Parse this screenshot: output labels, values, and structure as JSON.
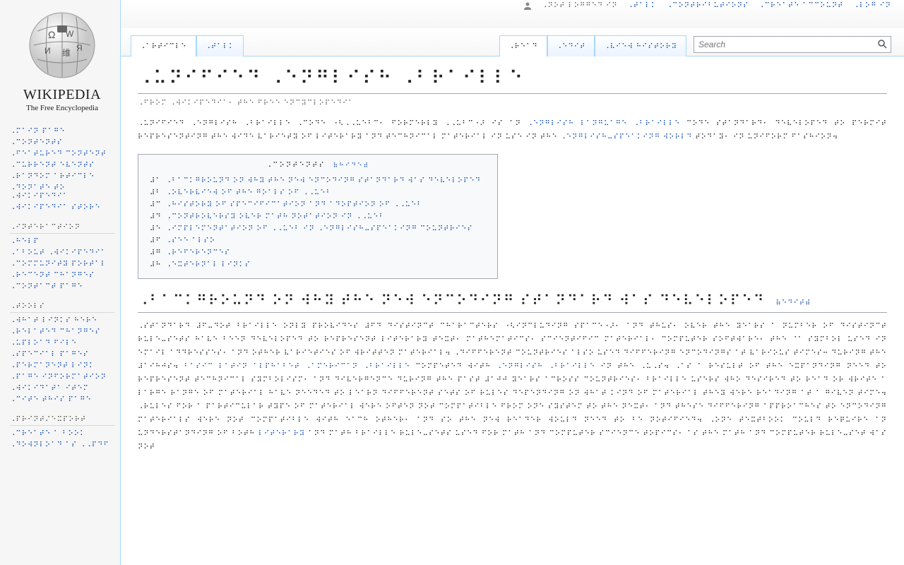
{
  "site": {
    "name": "WIKIPEDIA",
    "tagline": "The Free Encyclopedia"
  },
  "user_links": {
    "not_logged": "⠠⠝⠕⠞ ⠇⠕⠛⠛⠑⠙ ⠊⠝",
    "talk": "⠠⠞⠁⠇⠅",
    "contributions": "⠠⠉⠕⠝⠞⠗⠊⠃⠥⠞⠊⠕⠝⠎",
    "create": "⠠⠉⠗⠑⠁⠞⠑ ⠁⠉⠉⠕⠥⠝⠞",
    "login": "⠠⠇⠕⠛ ⠊⠝"
  },
  "nav": {
    "main": [
      "⠠⠍⠁⠊⠝ ⠏⠁⠛⠑",
      "⠠⠉⠕⠝⠞⠑⠝⠞⠎",
      "⠠⠋⠑⠁⠞⠥⠗⠑⠙ ⠉⠕⠝⠞⠑⠝⠞",
      "⠠⠉⠥⠗⠗⠑⠝⠞ ⠑⠧⠑⠝⠞⠎",
      "⠠⠗⠁⠝⠙⠕⠍ ⠁⠗⠞⠊⠉⠇⠑",
      "⠠⠙⠕⠝⠁⠞⠑ ⠞⠕ ⠠⠺⠊⠅⠊⠏⠑⠙⠊⠁",
      "⠠⠺⠊⠅⠊⠏⠑⠙⠊⠁ ⠎⠞⠕⠗⠑"
    ],
    "interaction_head": "⠠⠊⠝⠞⠑⠗⠁⠉⠞⠊⠕⠝",
    "interaction": [
      "⠠⠓⠑⠇⠏",
      "⠠⠁⠃⠕⠥⠞ ⠠⠺⠊⠅⠊⠏⠑⠙⠊⠁",
      "⠠⠉⠕⠍⠍⠥⠝⠊⠞⠽ ⠏⠕⠗⠞⠁⠇",
      "⠠⠗⠑⠉⠑⠝⠞ ⠉⠓⠁⠝⠛⠑⠎",
      "⠠⠉⠕⠝⠞⠁⠉⠞ ⠏⠁⠛⠑"
    ],
    "tools_head": "⠠⠞⠕⠕⠇⠎",
    "tools": [
      "⠠⠺⠓⠁⠞ ⠇⠊⠝⠅⠎ ⠓⠑⠗⠑",
      "⠠⠗⠑⠇⠁⠞⠑⠙ ⠉⠓⠁⠝⠛⠑⠎",
      "⠠⠥⠏⠇⠕⠁⠙ ⠋⠊⠇⠑",
      "⠠⠎⠏⠑⠉⠊⠁⠇ ⠏⠁⠛⠑⠎",
      "⠠⠏⠑⠗⠍⠁⠝⠑⠝⠞ ⠇⠊⠝⠅",
      "⠠⠏⠁⠛⠑ ⠊⠝⠋⠕⠗⠍⠁⠞⠊⠕⠝",
      "⠠⠺⠊⠅⠊⠙⠁⠞⠁ ⠊⠞⠑⠍",
      "⠠⠉⠊⠞⠑ ⠞⠓⠊⠎ ⠏⠁⠛⠑"
    ],
    "print_head": "⠠⠏⠗⠊⠝⠞⠌⠑⠭⠏⠕⠗⠞",
    "print": [
      "⠠⠉⠗⠑⠁⠞⠑ ⠁ ⠃⠕⠕⠅",
      "⠠⠙⠕⠺⠝⠇⠕⠁⠙ ⠁⠎ ⠠⠠⠏⠙⠋"
    ]
  },
  "tabs_left": {
    "article": "⠠⠁⠗⠞⠊⠉⠇⠑",
    "talk": "⠠⠞⠁⠇⠅"
  },
  "tabs_right": {
    "read": "⠠⠗⠑⠁⠙",
    "edit": "⠠⠑⠙⠊⠞",
    "history": "⠠⠧⠊⠑⠺ ⠓⠊⠎⠞⠕⠗⠽"
  },
  "search": {
    "placeholder": "Search"
  },
  "article": {
    "title": "⠠⠥⠝⠊⠋⠊⠑⠙ ⠠⠑⠝⠛⠇⠊⠎⠓ ⠠⠃⠗⠁⠊⠇⠇⠑",
    "from": "⠠⠋⠗⠕⠍ ⠠⠺⠊⠅⠊⠏⠑⠙⠊⠁⠂ ⠞⠓⠑ ⠋⠗⠑⠑ ⠑⠝⠉⠽⠉⠇⠕⠏⠑⠙⠊⠁",
    "intro_a": "⠠⠥⠝⠊⠋⠊⠑⠙ ⠠⠑⠝⠛⠇⠊⠎⠓ ⠠⠃⠗⠁⠊⠇⠇⠑ ⠠⠉⠕⠙⠑ ⠐⠣⠠⠠⠥⠑⠃⠉⠂ ⠋⠕⠗⠍⠑⠗⠇⠽ ⠠⠠⠥⠃⠉⠐⠜ ⠊⠎ ⠁⠝ ",
    "intro_link1": "⠠⠑⠝⠛⠇⠊⠎⠓ ⠇⠁⠝⠛⠥⠁⠛⠑",
    "intro_link2": "⠠⠃⠗⠁⠊⠇⠇⠑",
    "intro_b": " ⠉⠕⠙⠑ ⠎⠞⠁⠝⠙⠁⠗⠙⠂ ⠙⠑⠧⠑⠇⠕⠏⠑⠙ ⠞⠕ ⠏⠑⠗⠍⠊⠞ ⠗⠑⠏⠗⠑⠎⠑⠝⠞⠊⠝⠛ ⠞⠓⠑ ⠺⠊⠙⠑ ⠧⠁⠗⠊⠑⠞⠽ ⠕⠋ ⠇⠊⠞⠑⠗⠁⠗⠽ ⠁⠝⠙ ⠞⠑⠉⠓⠝⠊⠉⠁⠇ ⠍⠁⠞⠑⠗⠊⠁⠇ ⠊⠝ ⠥⠎⠑ ⠊⠝ ⠞⠓⠑ ",
    "intro_link3": "⠠⠑⠝⠛⠇⠊⠎⠓⠤⠎⠏⠑⠁⠅⠊⠝⠛ ⠺⠕⠗⠇⠙",
    "intro_c": " ⠞⠕⠙⠁⠽⠂ ⠊⠝ ⠥⠝⠊⠋⠕⠗⠍ ⠋⠁⠎⠓⠊⠕⠝⠲",
    "toc_head": "⠠⠉⠕⠝⠞⠑⠝⠞⠎",
    "toc_hide": "⠷⠓⠊⠙⠑⠾",
    "toc": [
      {
        "n": "⠼⠁",
        "t": "⠠⠃⠁⠉⠅⠛⠗⠕⠥⠝⠙ ⠕⠝ ⠺⠓⠽ ⠞⠓⠑ ⠝⠑⠺ ⠑⠝⠉⠕⠙⠊⠝⠛ ⠎⠞⠁⠝⠙⠁⠗⠙ ⠺⠁⠎ ⠙⠑⠧⠑⠇⠕⠏⠑⠙"
      },
      {
        "n": "⠼⠃",
        "t": "⠠⠕⠧⠑⠗⠧⠊⠑⠺ ⠕⠋ ⠞⠓⠑ ⠛⠕⠁⠇⠎ ⠕⠋ ⠠⠠⠥⠑⠃"
      },
      {
        "n": "⠼⠉",
        "t": "⠠⠓⠊⠎⠞⠕⠗⠽ ⠕⠋ ⠎⠏⠑⠉⠊⠋⠊⠉⠁⠞⠊⠕⠝ ⠁⠝⠙ ⠁⠙⠕⠏⠞⠊⠕⠝ ⠕⠋ ⠠⠠⠥⠑⠃"
      },
      {
        "n": "⠼⠙",
        "t": "⠠⠉⠕⠝⠞⠗⠕⠧⠑⠗⠎⠽ ⠕⠧⠑⠗ ⠍⠁⠞⠓ ⠝⠕⠞⠁⠞⠊⠕⠝ ⠊⠝ ⠠⠠⠥⠑⠃"
      },
      {
        "n": "⠼⠑",
        "t": "⠠⠊⠍⠏⠇⠑⠍⠑⠝⠞⠁⠞⠊⠕⠝ ⠕⠋ ⠠⠠⠥⠑⠃ ⠊⠝ ⠠⠑⠝⠛⠇⠊⠎⠓⠤⠎⠏⠑⠁⠅⠊⠝⠛ ⠉⠕⠥⠝⠞⠗⠊⠑⠎"
      },
      {
        "n": "⠼⠋",
        "t": "⠠⠎⠑⠑ ⠁⠇⠎⠕"
      },
      {
        "n": "⠼⠛",
        "t": "⠠⠗⠑⠋⠑⠗⠑⠝⠉⠑⠎"
      },
      {
        "n": "⠼⠓",
        "t": "⠠⠑⠭⠞⠑⠗⠝⠁⠇ ⠇⠊⠝⠅⠎"
      }
    ],
    "h2": "⠠⠃⠁⠉⠅⠛⠗⠕⠥⠝⠙ ⠕⠝ ⠺⠓⠽ ⠞⠓⠑ ⠝⠑⠺ ⠑⠝⠉⠕⠙⠊⠝⠛ ⠎⠞⠁⠝⠙⠁⠗⠙ ⠺⠁⠎ ⠙⠑⠧⠑⠇⠕⠏⠑⠙",
    "h2_edit": "⠷⠑⠙⠊⠞⠾",
    "body_a": "⠠⠎⠞⠁⠝⠙⠁⠗⠙ ⠼⠋⠤⠙⠕⠞ ⠃⠗⠁⠊⠇⠇⠑ ⠕⠝⠇⠽ ⠏⠗⠕⠧⠊⠙⠑⠎ ⠼⠋⠙ ⠙⠊⠎⠞⠊⠝⠉⠞ ⠉⠓⠁⠗⠁⠉⠞⠑⠗⠎ ⠐⠣⠊⠝⠉⠇⠥⠙⠊⠝⠛ ⠎⠏⠁⠉⠑⠐⠜⠂ ⠁⠝⠙ ⠞⠓⠥⠎⠂ ⠕⠧⠑⠗ ⠞⠓⠑ ⠽⠑⠁⠗⠎ ⠁ ⠝⠥⠍⠃⠑⠗ ⠕⠋ ⠙⠊⠎⠞⠊⠝⠉⠞ ⠗⠥⠇⠑⠤⠎⠑⠞⠎ ⠓⠁⠧⠑ ⠃⠑⠑⠝ ⠙⠑⠧⠑⠇⠕⠏⠑⠙ ⠞⠕ ⠗⠑⠏⠗⠑⠎⠑⠝⠞ ⠇⠊⠞⠑⠗⠁⠗⠽ ⠞⠑⠭⠞⠂ ⠍⠁⠞⠓⠑⠍⠁⠞⠊⠉⠎⠂ ⠎⠉⠊⠑⠝⠞⠊⠋⠊⠉ ⠍⠁⠞⠑⠗⠊⠁⠇⠂ ⠉⠕⠍⠏⠥⠞⠑⠗ ⠎⠕⠋⠞⠺⠁⠗⠑⠂ ⠞⠓⠑ ⠈⠁ ⠎⠽⠍⠃⠕⠇ ⠥⠎⠑⠙ ⠊⠝ ⠑⠍⠁⠊⠇ ⠁⠙⠙⠗⠑⠎⠎⠑⠎⠂ ⠁⠝⠙ ⠕⠞⠓⠑⠗ ⠧⠁⠗⠊⠑⠞⠊⠑⠎ ⠕⠋ ⠺⠗⠊⠞⠞⠑⠝ ⠍⠁⠞⠑⠗⠊⠁⠇⠲ ⠠⠙⠊⠋⠋⠑⠗⠑⠝⠞ ⠉⠕⠥⠝⠞⠗⠊⠑⠎ ⠁⠇⠎⠕ ⠥⠎⠑⠙ ⠙⠊⠋⠋⠑⠗⠊⠝⠛ ⠑⠝⠉⠕⠙⠊⠝⠛⠎ ⠁⠞ ⠧⠁⠗⠊⠕⠥⠎ ⠞⠊⠍⠑⠎⠒ ⠙⠥⠗⠊⠝⠛ ⠞⠓⠑ ⠼⠁⠊⠓⠚⠎⠲ ",
    "body_link1": "⠠⠁⠍⠑⠗⠊⠉⠁⠝ ⠠⠃⠗⠁⠊⠇⠇⠑",
    "body_b": " ⠉⠕⠍⠏⠑⠞⠑⠙ ⠺⠊⠞⠓ ",
    "body_link2": "⠠⠑⠝⠛⠇⠊⠎⠓ ⠠⠃⠗⠁⠊⠇⠇⠑",
    "body_c": " ⠊⠝ ⠞⠓⠑ ⠠⠥⠠⠎⠲ ⠠⠁⠎ ⠁ ⠗⠑⠎⠥⠇⠞ ⠕⠋ ⠞⠓⠑ ⠑⠭⠏⠁⠝⠙⠊⠝⠛ ⠝⠑⠑⠙ ⠞⠕ ⠗⠑⠏⠗⠑⠎⠑⠝⠞ ⠞⠑⠉⠓⠝⠊⠉⠁⠇ ⠎⠽⠍⠃⠕⠇⠊⠎⠍⠂ ⠁⠝⠙ ⠙⠊⠧⠑⠗⠛⠑⠝⠉⠑ ⠙⠥⠗⠊⠝⠛ ⠞⠓⠑ ⠏⠁⠎⠞ ⠼⠁⠚⠚ ⠽⠑⠁⠗⠎ ⠁⠉⠗⠕⠎⠎ ⠉⠕⠥⠝⠞⠗⠊⠑⠎⠂ ⠃⠗⠁⠊⠇⠇⠑ ⠥⠎⠑⠗⠎ ⠺⠓⠕ ⠙⠑⠎⠊⠗⠑⠙ ⠞⠕ ⠗⠑⠁⠙ ⠕⠗ ⠺⠗⠊⠞⠑ ⠁ ⠇⠁⠗⠛⠑ ⠗⠁⠝⠛⠑ ⠕⠋ ⠍⠁⠞⠑⠗⠊⠁⠇ ⠓⠁⠧⠑ ⠝⠑⠑⠙⠑⠙ ⠞⠕ ⠇⠑⠁⠗⠝ ⠙⠊⠋⠋⠑⠗⠑⠝⠞ ⠎⠑⠞⠎ ⠕⠋ ⠗⠥⠇⠑⠎ ⠙⠑⠏⠑⠝⠙⠊⠝⠛ ⠕⠝ ⠺⠓⠁⠞ ⠅⠊⠝⠙ ⠕⠋ ⠍⠁⠞⠑⠗⠊⠁⠇ ⠞⠓⠑⠽ ⠺⠑⠗⠑ ⠗⠑⠁⠙⠊⠝⠛ ⠁⠞ ⠁ ⠛⠊⠧⠑⠝ ⠞⠊⠍⠑⠲ ⠠⠗⠥⠇⠑⠎ ⠋⠕⠗ ⠁ ⠏⠁⠗⠞⠊⠉⠥⠇⠁⠗ ⠞⠽⠏⠑ ⠕⠋ ⠍⠁⠞⠑⠗⠊⠁⠇ ⠺⠑⠗⠑ ⠕⠋⠞⠑⠝ ⠝⠕⠞ ⠉⠕⠍⠏⠁⠞⠊⠃⠇⠑ ⠋⠗⠕⠍ ⠕⠝⠑ ⠎⠽⠎⠞⠑⠍ ⠞⠕ ⠞⠓⠑ ⠝⠑⠭⠞⠂ ⠁⠝⠙ ⠞⠓⠑⠎⠑ ⠙⠊⠋⠋⠑⠗⠊⠝⠛ ⠁⠏⠏⠗⠕⠁⠉⠓⠑⠎ ⠞⠕ ⠑⠝⠉⠕⠙⠊⠝⠛ ⠍⠁⠞⠑⠗⠊⠁⠇⠎ ⠺⠑⠗⠑ ⠝⠕⠞ ⠉⠕⠍⠏⠁⠞⠊⠃⠇⠑ ⠺⠊⠞⠓ ⠑⠁⠉⠓ ⠕⠞⠓⠑⠗⠂ ⠁⠝⠙ ⠎⠕ ⠞⠓⠑ ⠝⠑⠺ ⠗⠑⠁⠙⠑⠗ ⠺⠕⠥⠇⠙ ⠝⠑⠑⠙ ⠞⠕ ⠃⠑ ⠝⠕⠞⠊⠋⠊⠑⠙⠲ ⠠⠕⠝⠑ ⠞⠑⠭⠞⠃⠕⠕⠅ ⠉⠕⠥⠇⠙ ⠗⠑⠟⠥⠊⠗⠑ ⠁⠝ ⠥⠝⠙⠑⠗⠎⠞⠁⠝⠙⠊⠝⠛ ⠕⠋ ⠃⠕⠞⠓ ",
    "body_link3": "⠇⠊⠞⠑⠗⠁⠗⠽",
    "body_d": " ⠁⠝⠙ ⠍⠁⠞⠓ ⠃⠗⠁⠊⠇⠇⠑ ⠗⠥⠇⠑⠤⠎⠑⠞⠎ ⠥⠎⠑⠙ ⠋⠕⠗ ⠍⠁⠞⠓ ⠁⠝⠙ ⠉⠕⠍⠏⠥⠞⠑⠗ ⠎⠉⠊⠑⠝⠉⠑ ⠞⠕⠏⠊⠉⠎⠂ ⠁⠎ ⠞⠓⠑ ⠍⠁⠞⠓ ⠁⠝⠙ ⠉⠕⠍⠏⠥⠞⠑⠗ ⠗⠥⠇⠑⠤⠎⠑⠞ ⠺⠁⠎ ⠝⠕⠞",
    "body_link4": "⠃⠁⠎⠊⠉ ⠇⠁⠞⠊⠝ ⠁⠇⠏⠓⠁⠃⠑⠞"
  }
}
